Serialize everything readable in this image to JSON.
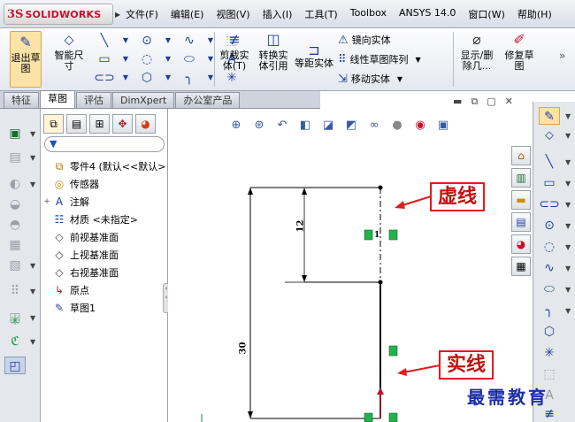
{
  "app": {
    "logo_prefix": "3S",
    "logo_name": "SOLIDWORKS"
  },
  "menu": [
    "文件(F)",
    "编辑(E)",
    "视图(V)",
    "插入(I)",
    "工具(T)",
    "Toolbox",
    "ANSYS 14.0",
    "窗口(W)",
    "帮助(H)"
  ],
  "ribbon": {
    "exit_sketch": "退出草图",
    "smart_dimension": "智能尺寸",
    "trim": "剪裁实体(T)",
    "convert": "转换实体引用",
    "offset": "等距实体",
    "mirror": "镜向实体",
    "linear_pattern": "线性草图阵列",
    "move": "移动实体",
    "show_delete": "显示/删除几...",
    "repair": "修复草图"
  },
  "tabs": [
    {
      "label": "特征",
      "active": false
    },
    {
      "label": "草图",
      "active": true
    },
    {
      "label": "评估",
      "active": false
    },
    {
      "label": "DimXpert",
      "active": false
    },
    {
      "label": "办公室产品",
      "active": false
    }
  ],
  "feature_tree": [
    {
      "label": "零件4 (默认<<默认>",
      "expand": "",
      "icon": "part-icon",
      "glyph": "⧉"
    },
    {
      "label": "传感器",
      "expand": "",
      "icon": "sensor-icon",
      "glyph": "◎"
    },
    {
      "label": "注解",
      "expand": "+",
      "icon": "annotation-icon",
      "glyph": "A"
    },
    {
      "label": "材质 <未指定>",
      "expand": "",
      "icon": "material-icon",
      "glyph": "☷"
    },
    {
      "label": "前视基准面",
      "expand": "",
      "icon": "plane-icon",
      "glyph": "◇"
    },
    {
      "label": "上视基准面",
      "expand": "",
      "icon": "plane-icon",
      "glyph": "◇"
    },
    {
      "label": "右视基准面",
      "expand": "",
      "icon": "plane-icon",
      "glyph": "◇"
    },
    {
      "label": "原点",
      "expand": "",
      "icon": "origin-icon",
      "glyph": "↳"
    },
    {
      "label": "草图1",
      "expand": "",
      "icon": "sketch-icon",
      "glyph": "✎"
    }
  ],
  "sketch": {
    "dim_vertical_short": "12",
    "dim_vertical_long": "30",
    "relation_label": "1"
  },
  "callouts": {
    "dashed": "虚线",
    "solid": "实线"
  },
  "watermark": "最需教育",
  "colors": {
    "accent": "#c8102e",
    "callout_red": "#e21b1b",
    "relation_green": "#22b14c",
    "sketch_line": "#000000",
    "watermark": "#1d2fa6"
  }
}
